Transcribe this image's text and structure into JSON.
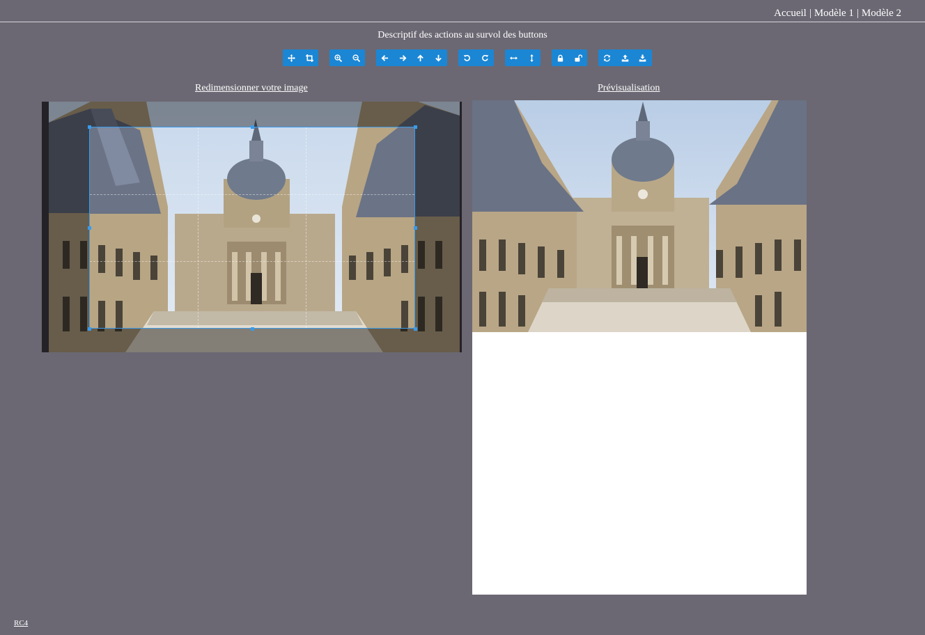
{
  "nav": {
    "home": "Accueil",
    "model1": "Modèle 1",
    "model2": "Modèle 2",
    "separator": "|"
  },
  "description": "Descriptif des actions au survol des buttons",
  "toolbar": {
    "groups": [
      [
        "move-icon",
        "crop-icon"
      ],
      [
        "zoom-in-icon",
        "zoom-out-icon"
      ],
      [
        "arrow-left-icon",
        "arrow-right-icon",
        "arrow-up-icon",
        "arrow-down-icon"
      ],
      [
        "rotate-left-icon",
        "rotate-right-icon"
      ],
      [
        "flip-horizontal-icon",
        "flip-vertical-icon"
      ],
      [
        "lock-icon",
        "unlock-icon"
      ],
      [
        "refresh-icon",
        "upload-icon",
        "download-icon"
      ]
    ],
    "button_color": "#1b86d4"
  },
  "editor": {
    "title": "Redimensionner votre image"
  },
  "preview": {
    "title": "Prévisualisation"
  },
  "footer": {
    "link": "RC4"
  },
  "colors": {
    "background": "#6b6873",
    "crop_border": "#3a9bea",
    "preview_bg": "#ffffff"
  }
}
